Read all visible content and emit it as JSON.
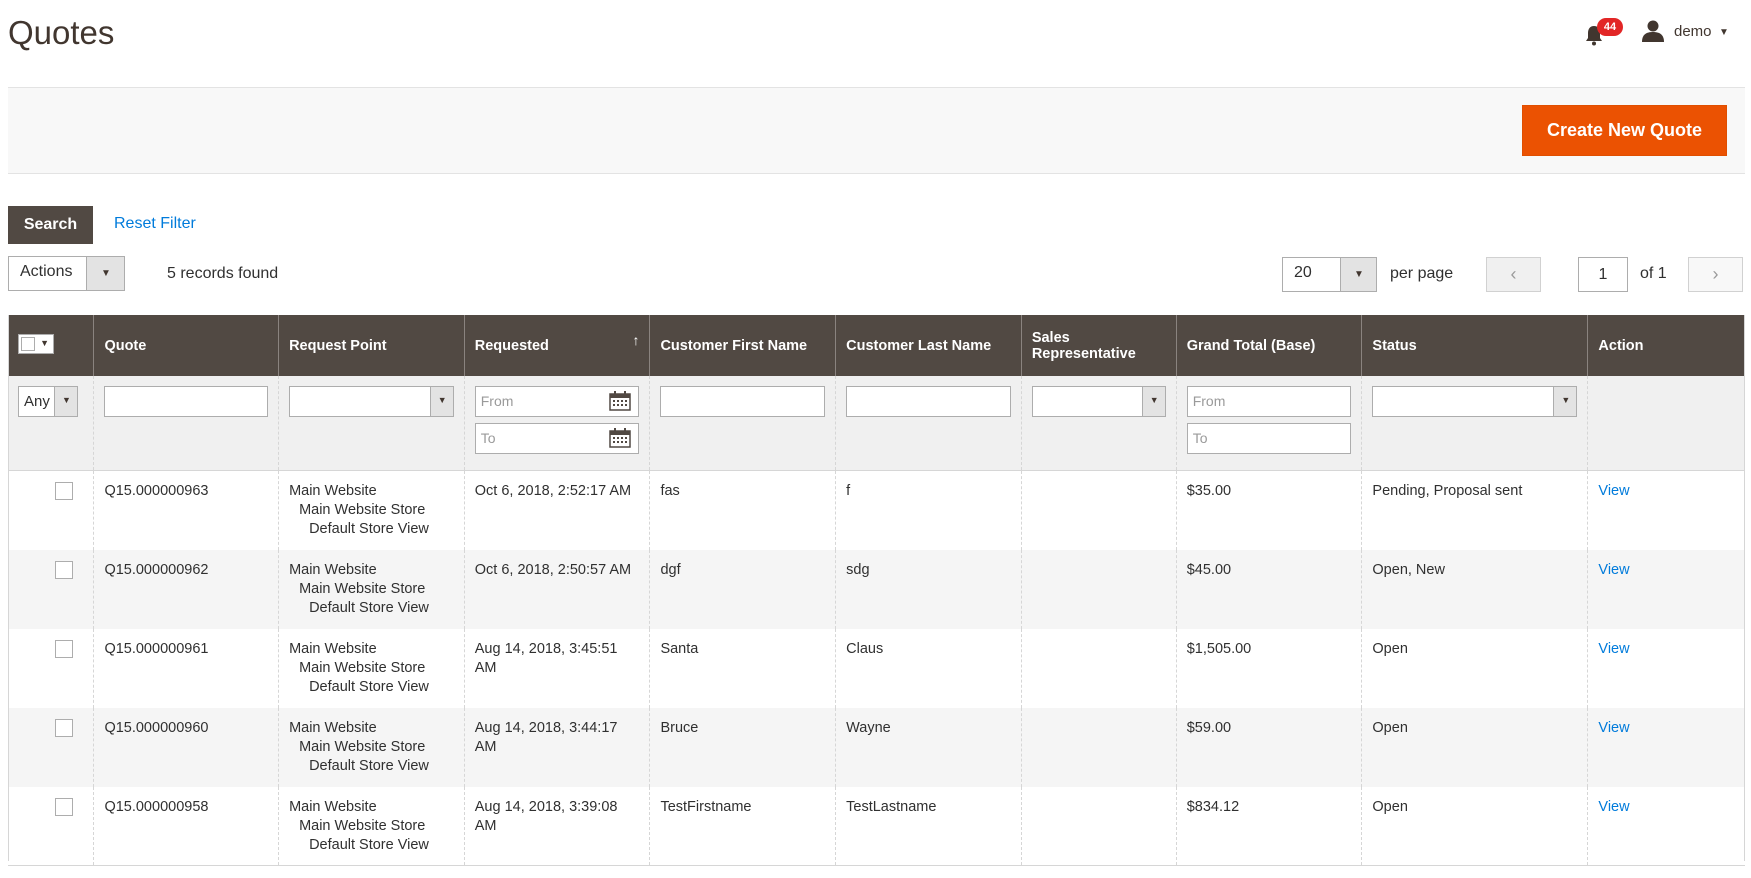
{
  "header": {
    "title": "Quotes",
    "notification_count": "44",
    "user_name": "demo"
  },
  "toolbar": {
    "create_label": "Create New Quote",
    "search_label": "Search",
    "reset_label": "Reset Filter",
    "actions_label": "Actions",
    "records_found": "5 records found",
    "per_page_value": "20",
    "per_page_label": "per page",
    "page_value": "1",
    "page_of": "of 1"
  },
  "grid": {
    "columns": [
      "",
      "Quote",
      "Request Point",
      "Requested",
      "Customer First Name",
      "Customer Last Name",
      "Sales Representative",
      "Grand Total (Base)",
      "Status",
      "Action"
    ],
    "sorted_column": "Requested",
    "sort_direction": "ascending",
    "filters": {
      "any_label": "Any",
      "from_placeholder": "From",
      "to_placeholder": "To"
    },
    "rows": [
      {
        "quote": "Q15.000000963",
        "website": "Main Website",
        "store": "Main Website Store",
        "store_view": "Default Store View",
        "requested": "Oct 6, 2018, 2:52:17 AM",
        "first_name": "fas",
        "last_name": "f",
        "sales_rep": "",
        "grand_total": "$35.00",
        "status": "Pending, Proposal sent",
        "action": "View"
      },
      {
        "quote": "Q15.000000962",
        "website": "Main Website",
        "store": "Main Website Store",
        "store_view": "Default Store View",
        "requested": "Oct 6, 2018, 2:50:57 AM",
        "first_name": "dgf",
        "last_name": "sdg",
        "sales_rep": "",
        "grand_total": "$45.00",
        "status": "Open, New",
        "action": "View"
      },
      {
        "quote": "Q15.000000961",
        "website": "Main Website",
        "store": "Main Website Store",
        "store_view": "Default Store View",
        "requested": "Aug 14, 2018, 3:45:51 AM",
        "first_name": "Santa",
        "last_name": "Claus",
        "sales_rep": "",
        "grand_total": "$1,505.00",
        "status": "Open",
        "action": "View"
      },
      {
        "quote": "Q15.000000960",
        "website": "Main Website",
        "store": "Main Website Store",
        "store_view": "Default Store View",
        "requested": "Aug 14, 2018, 3:44:17 AM",
        "first_name": "Bruce",
        "last_name": "Wayne",
        "sales_rep": "",
        "grand_total": "$59.00",
        "status": "Open",
        "action": "View"
      },
      {
        "quote": "Q15.000000958",
        "website": "Main Website",
        "store": "Main Website Store",
        "store_view": "Default Store View",
        "requested": "Aug 14, 2018, 3:39:08 AM",
        "first_name": "TestFirstname",
        "last_name": "TestLastname",
        "sales_rep": "",
        "grand_total": "$834.12",
        "status": "Open",
        "action": "View"
      }
    ]
  },
  "colors": {
    "accent": "#eb5202",
    "header_bg": "#514943",
    "link": "#007bdb",
    "badge": "#e22626"
  },
  "icons": [
    "bell-icon",
    "user-icon",
    "calendar-icon",
    "chevron-left-icon",
    "chevron-right-icon",
    "caret-down-icon",
    "sort-arrow-icon"
  ]
}
